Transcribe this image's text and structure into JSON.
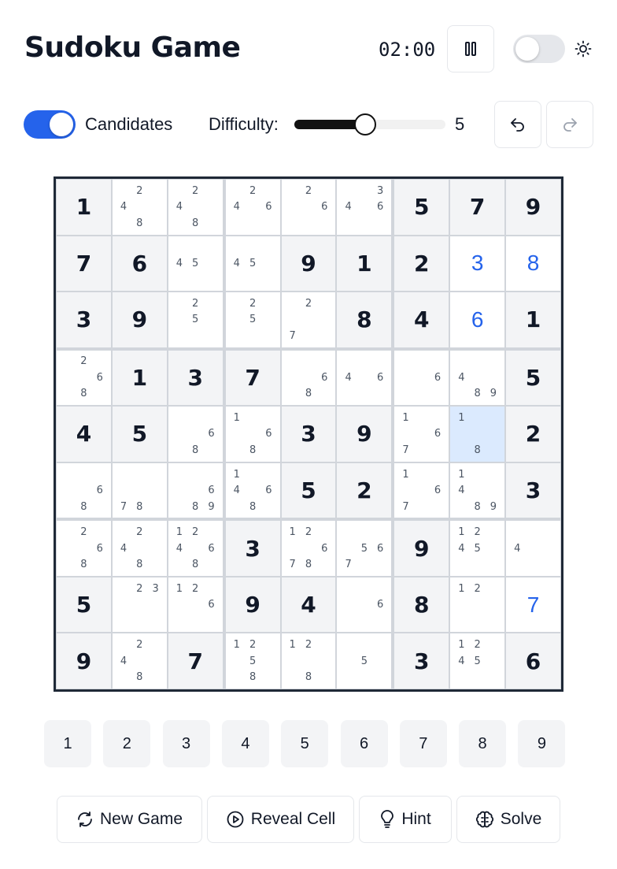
{
  "header": {
    "title": "Sudoku Game",
    "timer": "02:00",
    "pause_icon": "pause-icon",
    "theme_icon": "sun-icon",
    "theme_toggle_on": false
  },
  "controls": {
    "candidates_label": "Candidates",
    "candidates_on": true,
    "difficulty_label": "Difficulty:",
    "difficulty_value": "5",
    "difficulty_min": 1,
    "difficulty_max": 10,
    "undo_icon": "undo-icon",
    "redo_icon": "redo-icon"
  },
  "board": {
    "selected": [
      4,
      7
    ],
    "cells": [
      [
        {
          "v": "1",
          "g": true
        },
        {
          "c": [
            2,
            4,
            8
          ]
        },
        {
          "c": [
            2,
            4,
            8
          ]
        },
        {
          "c": [
            2,
            4,
            6
          ]
        },
        {
          "c": [
            2,
            6
          ]
        },
        {
          "c": [
            3,
            4,
            6
          ]
        },
        {
          "v": "5",
          "g": true
        },
        {
          "v": "7",
          "g": true
        },
        {
          "v": "9",
          "g": true
        }
      ],
      [
        {
          "v": "7",
          "g": true
        },
        {
          "v": "6",
          "g": true
        },
        {
          "c": [
            4,
            5
          ]
        },
        {
          "c": [
            4,
            5
          ]
        },
        {
          "v": "9",
          "g": true
        },
        {
          "v": "1",
          "g": true
        },
        {
          "v": "2",
          "g": true
        },
        {
          "v": "3",
          "g": false
        },
        {
          "v": "8",
          "g": false
        }
      ],
      [
        {
          "v": "3",
          "g": true
        },
        {
          "v": "9",
          "g": true
        },
        {
          "c": [
            2,
            5
          ]
        },
        {
          "c": [
            2,
            5
          ]
        },
        {
          "c": [
            2,
            7
          ]
        },
        {
          "v": "8",
          "g": true
        },
        {
          "v": "4",
          "g": true
        },
        {
          "v": "6",
          "g": false
        },
        {
          "v": "1",
          "g": true
        }
      ],
      [
        {
          "c": [
            2,
            6,
            8
          ]
        },
        {
          "v": "1",
          "g": true
        },
        {
          "v": "3",
          "g": true
        },
        {
          "v": "7",
          "g": true
        },
        {
          "c": [
            6,
            8
          ]
        },
        {
          "c": [
            4,
            6
          ]
        },
        {
          "c": [
            6
          ]
        },
        {
          "c": [
            4,
            8,
            9
          ]
        },
        {
          "v": "5",
          "g": true
        }
      ],
      [
        {
          "v": "4",
          "g": true
        },
        {
          "v": "5",
          "g": true
        },
        {
          "c": [
            6,
            8
          ]
        },
        {
          "c": [
            1,
            6,
            8
          ]
        },
        {
          "v": "3",
          "g": true
        },
        {
          "v": "9",
          "g": true
        },
        {
          "c": [
            1,
            6,
            7
          ]
        },
        {
          "c": [
            1,
            8
          ]
        },
        {
          "v": "2",
          "g": true
        }
      ],
      [
        {
          "c": [
            6,
            8
          ]
        },
        {
          "c": [
            7,
            8
          ]
        },
        {
          "c": [
            6,
            8,
            9
          ]
        },
        {
          "c": [
            1,
            4,
            6,
            8
          ]
        },
        {
          "v": "5",
          "g": true
        },
        {
          "v": "2",
          "g": true
        },
        {
          "c": [
            1,
            6,
            7
          ]
        },
        {
          "c": [
            1,
            4,
            8,
            9
          ]
        },
        {
          "v": "3",
          "g": true
        }
      ],
      [
        {
          "c": [
            2,
            6,
            8
          ]
        },
        {
          "c": [
            2,
            4,
            8
          ]
        },
        {
          "c": [
            1,
            2,
            4,
            6,
            8
          ]
        },
        {
          "v": "3",
          "g": true
        },
        {
          "c": [
            1,
            2,
            6,
            7,
            8
          ]
        },
        {
          "c": [
            5,
            6,
            7
          ]
        },
        {
          "v": "9",
          "g": true
        },
        {
          "c": [
            1,
            2,
            4,
            5
          ]
        },
        {
          "c": [
            4
          ]
        }
      ],
      [
        {
          "v": "5",
          "g": true
        },
        {
          "c": [
            2,
            3
          ]
        },
        {
          "c": [
            1,
            2,
            6
          ]
        },
        {
          "v": "9",
          "g": true
        },
        {
          "v": "4",
          "g": true
        },
        {
          "c": [
            6
          ]
        },
        {
          "v": "8",
          "g": true
        },
        {
          "c": [
            1,
            2
          ]
        },
        {
          "v": "7",
          "g": false
        }
      ],
      [
        {
          "v": "9",
          "g": true
        },
        {
          "c": [
            2,
            4,
            8
          ]
        },
        {
          "v": "7",
          "g": true
        },
        {
          "c": [
            1,
            2,
            5,
            8
          ]
        },
        {
          "c": [
            1,
            2,
            8
          ]
        },
        {
          "c": [
            5
          ]
        },
        {
          "v": "3",
          "g": true
        },
        {
          "c": [
            1,
            2,
            4,
            5
          ]
        },
        {
          "v": "6",
          "g": true
        }
      ]
    ]
  },
  "numpad": [
    "1",
    "2",
    "3",
    "4",
    "5",
    "6",
    "7",
    "8",
    "9"
  ],
  "actions": {
    "new_game": {
      "label": "New Game",
      "icon": "refresh-icon"
    },
    "reveal_cell": {
      "label": "Reveal Cell",
      "icon": "play-circle-icon"
    },
    "hint": {
      "label": "Hint",
      "icon": "lightbulb-icon"
    },
    "solve": {
      "label": "Solve",
      "icon": "brain-icon"
    }
  }
}
